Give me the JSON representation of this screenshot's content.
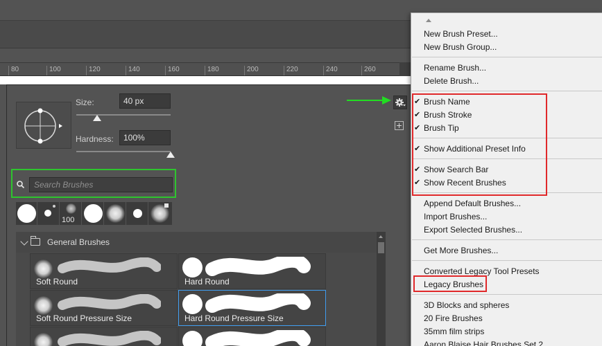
{
  "ruler": {
    "labels": [
      "80",
      "100",
      "120",
      "140",
      "160",
      "180",
      "200",
      "220",
      "240",
      "260"
    ]
  },
  "brush_settings": {
    "size_label": "Size:",
    "size_value": "40 px",
    "size_level": 0.22,
    "hardness_label": "Hardness:",
    "hardness_value": "100%",
    "hardness_level": 1.0
  },
  "search": {
    "placeholder": "Search Brushes"
  },
  "recent_brushes": {
    "count_label": "100"
  },
  "brush_group": {
    "name": "General Brushes",
    "brushes": [
      {
        "label": "Soft Round",
        "kind": "soft",
        "selected": false
      },
      {
        "label": "Hard Round",
        "kind": "hard",
        "selected": false
      },
      {
        "label": "Soft Round Pressure Size",
        "kind": "soft",
        "selected": false
      },
      {
        "label": "Hard Round Pressure Size",
        "kind": "hard",
        "selected": true
      },
      {
        "label": "",
        "kind": "soft",
        "selected": false
      },
      {
        "label": "",
        "kind": "hard",
        "selected": false
      }
    ]
  },
  "menu": {
    "items": [
      {
        "label": "New Brush Preset...",
        "checked": false
      },
      {
        "label": "New Brush Group...",
        "checked": false
      },
      {
        "label": "Rename Brush...",
        "checked": false
      },
      {
        "label": "Delete Brush...",
        "checked": false
      },
      {
        "label": "Brush Name",
        "checked": true
      },
      {
        "label": "Brush Stroke",
        "checked": true
      },
      {
        "label": "Brush Tip",
        "checked": true
      },
      {
        "label": "Show Additional Preset Info",
        "checked": true
      },
      {
        "label": "Show Search Bar",
        "checked": true
      },
      {
        "label": "Show Recent Brushes",
        "checked": true
      },
      {
        "label": "Append Default Brushes...",
        "checked": false
      },
      {
        "label": "Import Brushes...",
        "checked": false
      },
      {
        "label": "Export Selected Brushes...",
        "checked": false
      },
      {
        "label": "Get More Brushes...",
        "checked": false
      },
      {
        "label": "Converted Legacy Tool Presets",
        "checked": false
      },
      {
        "label": "Legacy Brushes",
        "checked": false
      },
      {
        "label": "3D Blocks and spheres",
        "checked": false
      },
      {
        "label": "20 Fire Brushes",
        "checked": false
      },
      {
        "label": "35mm film strips",
        "checked": false
      },
      {
        "label": "Aaron Blaise Hair Brushes Set 2",
        "checked": false
      }
    ],
    "check_mark": "✔"
  },
  "annotation_colors": {
    "highlight_green": "#2ec52e",
    "highlight_red": "#e0282a",
    "selection_blue": "#3f9cef"
  }
}
